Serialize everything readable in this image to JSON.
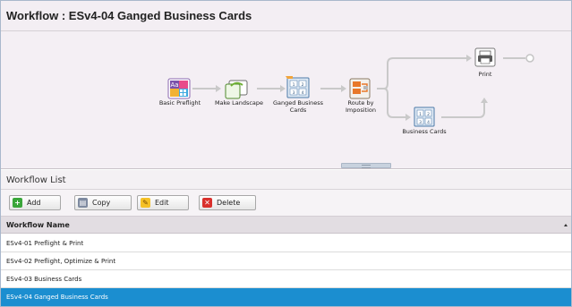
{
  "header": {
    "title": "Workflow : ESv4-04 Ganged Business Cards"
  },
  "workflow": {
    "nodes": [
      {
        "id": "basic-preflight",
        "label": "Basic Preflight",
        "icon": "preflight-icon"
      },
      {
        "id": "make-landscape",
        "label": "Make Landscape",
        "icon": "rotate-icon"
      },
      {
        "id": "ganged-business-cards",
        "label": "Ganged Business\nCards",
        "icon": "ganged-icon"
      },
      {
        "id": "route-by-imposition",
        "label": "Route by\nImposition",
        "icon": "route-icon"
      },
      {
        "id": "print",
        "label": "Print",
        "icon": "printer-icon"
      },
      {
        "id": "business-cards",
        "label": "Business Cards",
        "icon": "ganged-icon"
      }
    ]
  },
  "list": {
    "title": "Workflow List",
    "toolbar": {
      "add": "Add",
      "copy": "Copy",
      "edit": "Edit",
      "delete": "Delete"
    },
    "column": "Workflow Name",
    "rows": [
      "ESv4-01 Preflight & Print",
      "ESv4-02 Preflight, Optimize & Print",
      "ESv4-03 Business Cards",
      "ESv4-04 Ganged Business Cards"
    ],
    "selected_index": 3
  },
  "colors": {
    "accent": "#1b8ed0",
    "canvas_bg": "#f4eff4",
    "connector": "#c8c8c8"
  }
}
